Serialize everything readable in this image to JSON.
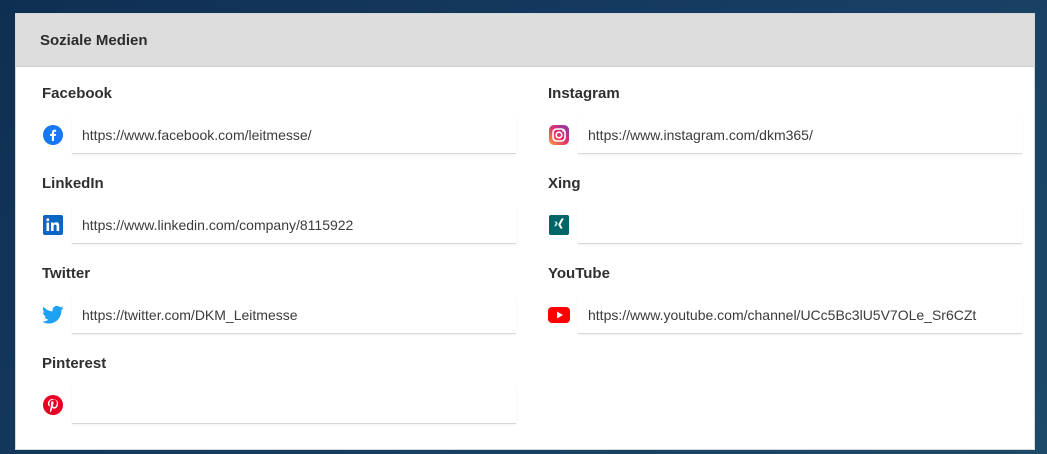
{
  "card": {
    "title": "Soziale Medien"
  },
  "fields": {
    "facebook": {
      "label": "Facebook",
      "value": "https://www.facebook.com/leitmesse/",
      "icon": "facebook-icon",
      "color": "#1877f2"
    },
    "instagram": {
      "label": "Instagram",
      "value": "https://www.instagram.com/dkm365/",
      "icon": "instagram-icon",
      "color": "#e1306c"
    },
    "linkedin": {
      "label": "LinkedIn",
      "value": "https://www.linkedin.com/company/8115922",
      "icon": "linkedin-icon",
      "color": "#0a66c2"
    },
    "xing": {
      "label": "Xing",
      "value": "",
      "icon": "xing-icon",
      "color": "#006567"
    },
    "twitter": {
      "label": "Twitter",
      "value": "https://twitter.com/DKM_Leitmesse",
      "icon": "twitter-icon",
      "color": "#1da1f2"
    },
    "youtube": {
      "label": "YouTube",
      "value": "https://www.youtube.com/channel/UCc5Bc3lU5V7OLe_Sr6CZt",
      "icon": "youtube-icon",
      "color": "#ff0000"
    },
    "pinterest": {
      "label": "Pinterest",
      "value": "",
      "icon": "pinterest-icon",
      "color": "#e60023"
    }
  }
}
